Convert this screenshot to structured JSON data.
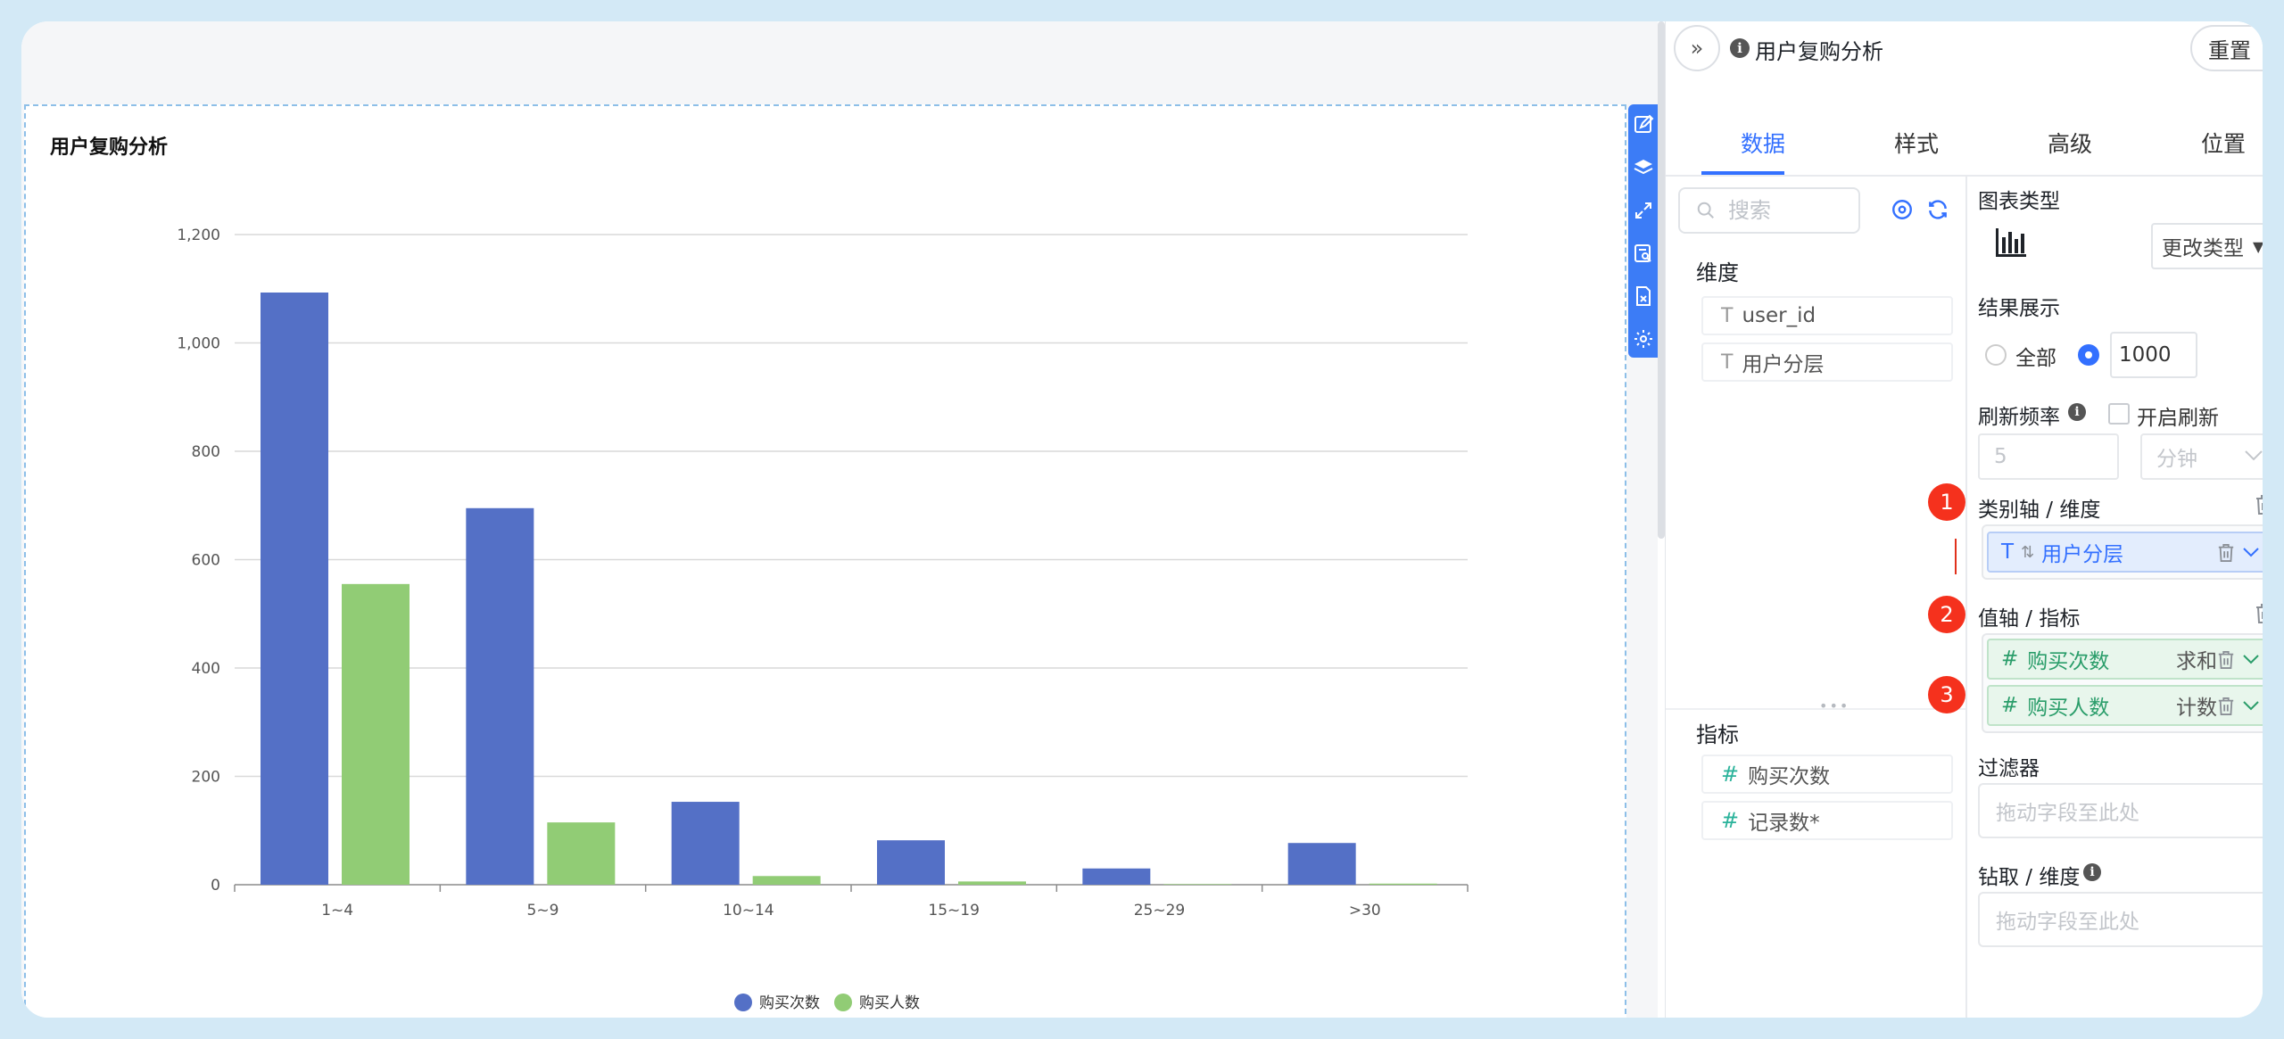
{
  "chart_card": {
    "title": "用户复购分析"
  },
  "chart_data": {
    "type": "bar",
    "categories": [
      "1~4",
      "5~9",
      "10~14",
      "15~19",
      "25~29",
      ">30"
    ],
    "series": [
      {
        "name": "购买次数",
        "color": "#5470c6",
        "values": [
          1093,
          695,
          153,
          82,
          30,
          77
        ]
      },
      {
        "name": "购买人数",
        "color": "#91cc75",
        "values": [
          555,
          115,
          16,
          6,
          1,
          2
        ]
      }
    ],
    "y_ticks": [
      "0",
      "200",
      "400",
      "600",
      "800",
      "1,000",
      "1,200"
    ],
    "ylim": [
      0,
      1200
    ],
    "grid": true,
    "legend": "bottom-center"
  },
  "tool_strip": {
    "icons": [
      "edit-icon",
      "layers-icon",
      "expand-icon",
      "search-data-icon",
      "export-icon",
      "settings-icon"
    ]
  },
  "panel": {
    "title": "用户复购分析",
    "reset_label": "重置",
    "tabs": [
      "数据",
      "样式",
      "高级",
      "位置"
    ],
    "active_tab": 0,
    "search_placeholder": "搜索",
    "dimension_section": "维度",
    "dimension_fields": [
      "user_id",
      "用户分层"
    ],
    "measure_section": "指标",
    "measure_fields": [
      "购买次数",
      "记录数*"
    ],
    "chart_type_label": "图表类型",
    "change_type_label": "更改类型",
    "result_display_label": "结果展示",
    "radio_all_label": "全部",
    "result_limit": "1000",
    "refresh_rate_label": "刷新频率",
    "enable_refresh_label": "开启刷新",
    "refresh_value": "5",
    "refresh_unit": "分钟",
    "category_axis_label": "类别轴 / 维度",
    "category_pill": "用户分层",
    "value_axis_label": "值轴 / 指标",
    "value_pills": [
      {
        "label": "购买次数",
        "agg": "求和"
      },
      {
        "label": "购买人数",
        "agg": "计数"
      }
    ],
    "filter_label": "过滤器",
    "filter_placeholder": "拖动字段至此处",
    "drill_label": "钻取 / 维度",
    "drill_placeholder": "拖动字段至此处",
    "markers": [
      "1",
      "2",
      "3"
    ],
    "accent_color": "#3370ff"
  }
}
